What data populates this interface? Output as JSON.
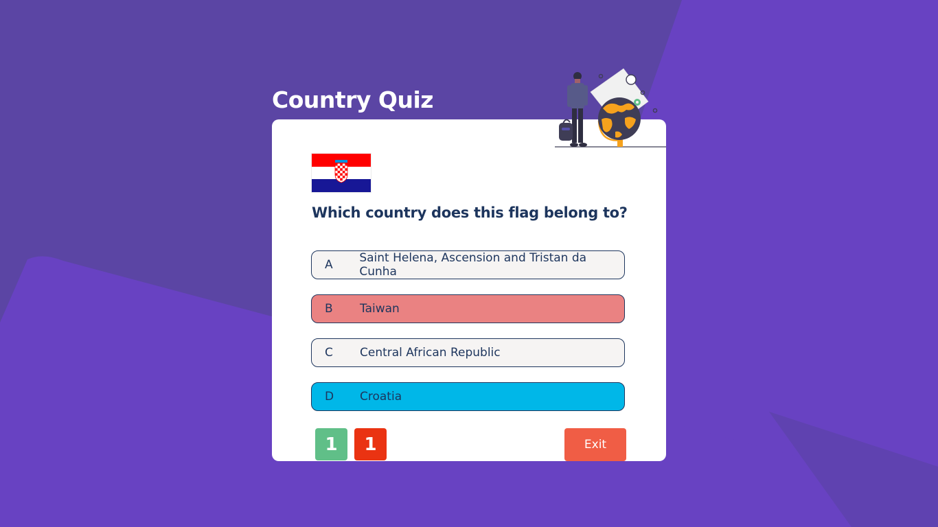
{
  "app": {
    "title": "Country Quiz"
  },
  "colors": {
    "background": "#5b45a4",
    "background_shape": "#6842c2",
    "card": "#ffffff",
    "text_dark": "#1d355d",
    "option_default": "#f6f4f3",
    "option_wrong": "#ea8282",
    "option_correct": "#00b7e8",
    "score_correct": "#60bf88",
    "score_wrong": "#ea3312",
    "exit_button": "#f05d45"
  },
  "quiz": {
    "flag_icon": "croatia-flag-icon",
    "question": "Which country does this flag belong to?",
    "options": [
      {
        "letter": "A",
        "text": "Saint Helena, Ascension and Tristan da Cunha",
        "state": "default"
      },
      {
        "letter": "B",
        "text": "Taiwan",
        "state": "wrong"
      },
      {
        "letter": "C",
        "text": "Central African Republic",
        "state": "default"
      },
      {
        "letter": "D",
        "text": "Croatia",
        "state": "correct"
      }
    ]
  },
  "score": {
    "correct": "1",
    "wrong": "1"
  },
  "buttons": {
    "exit_label": "Exit"
  },
  "illustration": {
    "icon": "traveler-globe-illustration"
  }
}
